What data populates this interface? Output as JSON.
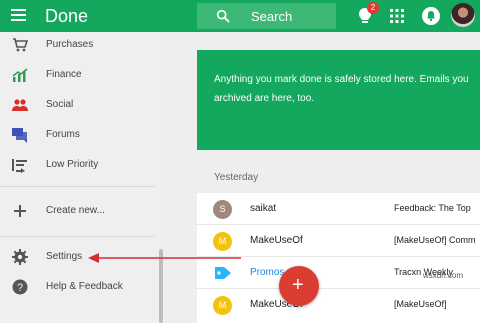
{
  "colors": {
    "primary": "#14a75e",
    "accent": "#db3d32",
    "link": "#1e88e5",
    "annotation_arrow": "#d32f2f"
  },
  "header": {
    "title": "Done",
    "search_label": "Search",
    "reminder_badge": "2",
    "icons": [
      "menu-icon",
      "search-icon",
      "reminder-icon",
      "apps-icon",
      "notifications-icon",
      "avatar"
    ]
  },
  "sidebar": {
    "items": [
      {
        "label": "Purchases",
        "icon": "cart-icon"
      },
      {
        "label": "Finance",
        "icon": "chart-icon"
      },
      {
        "label": "Social",
        "icon": "people-icon"
      },
      {
        "label": "Forums",
        "icon": "forum-icon"
      },
      {
        "label": "Low Priority",
        "icon": "low-priority-icon"
      }
    ],
    "create_label": "Create new...",
    "settings_label": "Settings",
    "help_label": "Help & Feedback"
  },
  "main": {
    "banner_line1": "Anything you mark done is safely stored here. Emails you",
    "banner_line2": "archived are here, too.",
    "section_title": "Yesterday",
    "emails": [
      {
        "avatar": "S",
        "sender": "saikat",
        "subject": "Feedback: The Top",
        "avatar_color": "#a1887f"
      },
      {
        "avatar": "M",
        "sender": "MakeUseOf",
        "subject": "[MakeUseOf] Comm",
        "avatar_color": "#f4c20d"
      },
      {
        "avatar": "",
        "sender": "Promos",
        "subject": "Tracxn Weekly",
        "avatar_color": "#29b6f6"
      },
      {
        "avatar": "M",
        "sender": "MakeUseOf",
        "subject": "[MakeUseOf]",
        "avatar_color": "#f4c20d"
      }
    ]
  },
  "fab": {
    "symbol": "+"
  },
  "watermark": "wsxdn.com"
}
